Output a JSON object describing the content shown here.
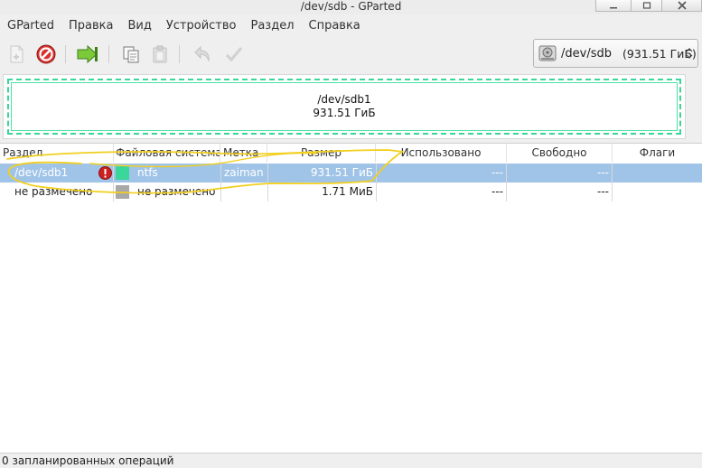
{
  "window": {
    "title": "/dev/sdb - GParted"
  },
  "menu": [
    "GParted",
    "Правка",
    "Вид",
    "Устройство",
    "Раздел",
    "Справка"
  ],
  "toolbar": {
    "buttons": [
      {
        "icon": "new-partition-icon",
        "enabled": false
      },
      {
        "icon": "delete-icon",
        "enabled": true
      },
      {
        "icon": "resize-move-icon",
        "enabled": true
      },
      {
        "icon": "copy-icon",
        "enabled": true
      },
      {
        "icon": "paste-icon",
        "enabled": false
      },
      {
        "icon": "undo-icon",
        "enabled": false
      },
      {
        "icon": "apply-icon",
        "enabled": false
      }
    ]
  },
  "device": {
    "name": "/dev/sdb",
    "size": "(931.51 ГиБ)"
  },
  "diskmap": {
    "partition": "/dev/sdb1",
    "size": "931.51 ГиБ",
    "color": "#3bd69a"
  },
  "table": {
    "headers": {
      "partition": "Раздел",
      "filesystem": "Файловая система",
      "label": "Метка",
      "size": "Размер",
      "used": "Использовано",
      "free": "Свободно",
      "flags": "Флаги"
    },
    "rows": [
      {
        "partition": "/dev/sdb1",
        "warning": true,
        "fs_color": "#3bd69a",
        "filesystem": "ntfs",
        "label": "zaiman",
        "size": "931.51 ГиБ",
        "used": "---",
        "free": "---",
        "flags": "",
        "selected": true
      },
      {
        "partition": "не размечено",
        "warning": false,
        "fs_color": "#a8a8a8",
        "filesystem": "не размечено",
        "label": "",
        "size": "1.71 МиБ",
        "used": "---",
        "free": "---",
        "flags": "",
        "selected": false
      }
    ]
  },
  "status": {
    "text": "0 запланированных операций"
  }
}
